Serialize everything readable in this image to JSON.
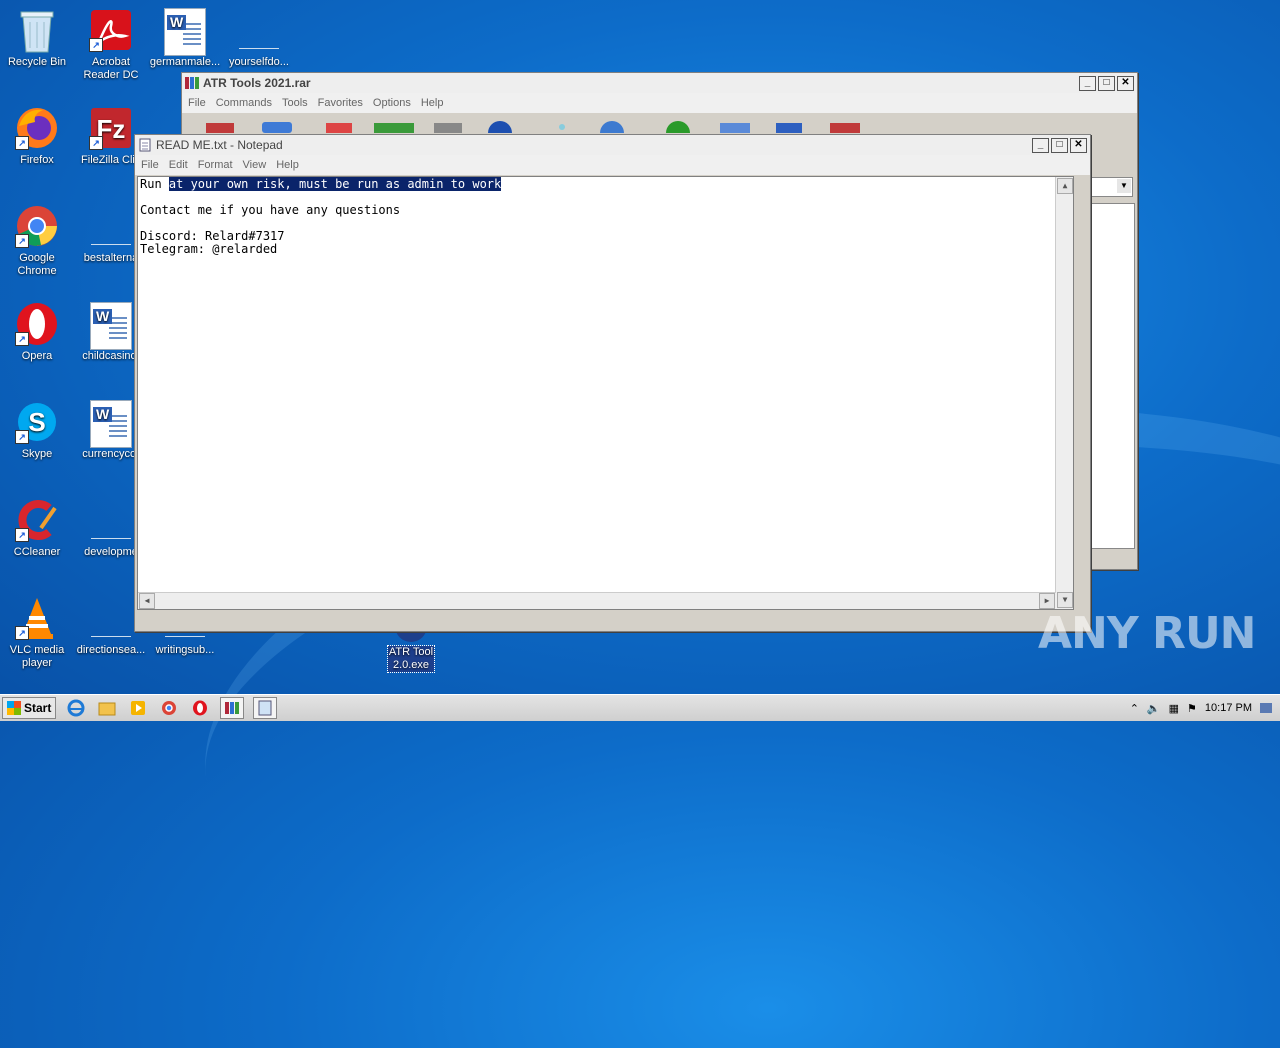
{
  "desktop": {
    "icons": [
      {
        "id": "recycle",
        "label": "Recycle Bin"
      },
      {
        "id": "acrobat",
        "label": "Acrobat Reader DC"
      },
      {
        "id": "germanmale",
        "label": "germanmale..."
      },
      {
        "id": "yourselfdo",
        "label": "yourselfdo..."
      },
      {
        "id": "firefox",
        "label": "Firefox"
      },
      {
        "id": "filezilla",
        "label": "FileZilla Clie"
      },
      {
        "id": "chrome",
        "label": "Google Chrome"
      },
      {
        "id": "bestalterna",
        "label": "bestalterna"
      },
      {
        "id": "opera",
        "label": "Opera"
      },
      {
        "id": "childcasino",
        "label": "childcasino."
      },
      {
        "id": "skype",
        "label": "Skype"
      },
      {
        "id": "currencycon",
        "label": "currencycor"
      },
      {
        "id": "ccleaner",
        "label": "CCleaner"
      },
      {
        "id": "developme",
        "label": "developme"
      },
      {
        "id": "vlc",
        "label": "VLC media player"
      },
      {
        "id": "directionsea",
        "label": "directionsea..."
      },
      {
        "id": "writingsub",
        "label": "writingsub..."
      },
      {
        "id": "atrtool",
        "label": "ATR Tool 2.0.exe"
      }
    ]
  },
  "winrar": {
    "title": "ATR Tools 2021.rar",
    "menu": [
      "File",
      "Commands",
      "Tools",
      "Favorites",
      "Options",
      "Help"
    ]
  },
  "notepad": {
    "title": "READ ME.txt - Notepad",
    "menu": [
      "File",
      "Edit",
      "Format",
      "View",
      "Help"
    ],
    "lines": [
      {
        "plain": "Run ",
        "selected": "at your own risk, must be run as admin to work"
      },
      {
        "plain": "",
        "selected": ""
      },
      {
        "plain": "Contact me if you have any questions",
        "selected": ""
      },
      {
        "plain": "",
        "selected": ""
      },
      {
        "plain": "Discord: Relard#7317",
        "selected": ""
      },
      {
        "plain": "Telegram: @relarded",
        "selected": ""
      }
    ]
  },
  "taskbar": {
    "start": "Start",
    "clock": "10:17 PM"
  },
  "watermark": "ANY RUN",
  "colors": {
    "selection": "#0a246a",
    "desktop": "#0d6cc9"
  }
}
